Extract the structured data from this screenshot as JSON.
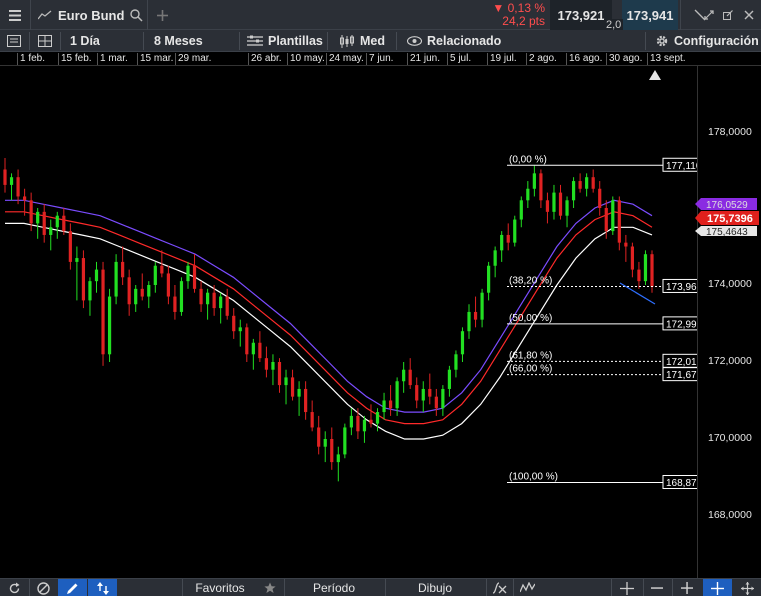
{
  "header": {
    "instrument": "Euro Bund",
    "change_pct": "▼ 0,13 %",
    "change_pts": "24,2 pts",
    "bid": "173,921",
    "spread": "2,0",
    "ask": "173,941"
  },
  "toolbar": {
    "interval": "1 Día",
    "range": "8 Meses",
    "templates": "Plantillas",
    "candle_type": "Med",
    "related": "Relacionado",
    "settings": "Configuración"
  },
  "date_axis": [
    "1 feb.",
    "15 feb.",
    "1 mar.",
    "15 mar.",
    "29 mar.",
    "26 abr.",
    "10 may.",
    "24 may.",
    "7 jun.",
    "21 jun.",
    "5 jul.",
    "19 jul.",
    "2 ago.",
    "16 ago.",
    "30 ago.",
    "13 sept."
  ],
  "price_axis": [
    "178,0000",
    "174,0000",
    "172,0000",
    "170,0000",
    "168,0000"
  ],
  "fibonacci": [
    {
      "level": "(0,00 %)",
      "price": "177,1100"
    },
    {
      "level": "(38,20 %)",
      "price": "173,9623"
    },
    {
      "level": "(50,00 %)",
      "price": "172,9900"
    },
    {
      "level": "(61,80 %)",
      "price": "172,0177"
    },
    {
      "level": "(66,00 %)",
      "price": "171,6716"
    },
    {
      "level": "(100,00 %)",
      "price": "168,8700"
    }
  ],
  "price_badges": {
    "purple": "176,0529",
    "current": "175,7396",
    "white": "175,4643"
  },
  "bottom": {
    "favorites": "Favoritos",
    "period": "Período",
    "drawing": "Dibujo"
  },
  "colors": {
    "up": "#22e022",
    "down": "#e02222",
    "ema_purple": "#7b4cff",
    "ema_red": "#ff2a2a",
    "ema_white": "#ffffff",
    "current_badge": "#e0201c",
    "purple_badge": "#8a2be2"
  },
  "chart_data": {
    "type": "candlestick",
    "ylim": [
      167.5,
      180.0
    ],
    "price_ticks": [
      178,
      174,
      172,
      170,
      168
    ],
    "candles": [
      [
        177.0,
        177.3,
        176.4,
        176.6
      ],
      [
        176.6,
        176.9,
        176.2,
        176.8
      ],
      [
        176.8,
        177.0,
        176.1,
        176.3
      ],
      [
        176.3,
        176.5,
        175.8,
        176.2
      ],
      [
        176.2,
        176.4,
        175.4,
        175.6
      ],
      [
        175.6,
        176.0,
        175.2,
        175.9
      ],
      [
        175.9,
        176.1,
        175.1,
        175.3
      ],
      [
        175.3,
        175.7,
        174.9,
        175.5
      ],
      [
        175.5,
        175.9,
        175.2,
        175.8
      ],
      [
        175.8,
        176.0,
        175.3,
        175.4
      ],
      [
        175.4,
        175.6,
        174.4,
        174.6
      ],
      [
        174.6,
        175.0,
        173.6,
        174.7
      ],
      [
        174.7,
        174.9,
        173.4,
        173.6
      ],
      [
        173.6,
        174.2,
        173.2,
        174.1
      ],
      [
        174.1,
        174.6,
        173.8,
        174.4
      ],
      [
        174.4,
        174.6,
        171.9,
        172.2
      ],
      [
        172.2,
        173.9,
        172.0,
        173.7
      ],
      [
        173.7,
        174.8,
        173.5,
        174.6
      ],
      [
        174.6,
        175.0,
        174.0,
        174.2
      ],
      [
        174.2,
        174.4,
        173.2,
        173.5
      ],
      [
        173.5,
        174.0,
        173.3,
        173.9
      ],
      [
        173.9,
        174.3,
        173.6,
        173.7
      ],
      [
        173.7,
        174.1,
        173.4,
        174.0
      ],
      [
        174.0,
        174.6,
        173.8,
        174.5
      ],
      [
        174.5,
        174.9,
        174.2,
        174.3
      ],
      [
        174.3,
        174.5,
        173.5,
        173.7
      ],
      [
        173.7,
        174.0,
        173.1,
        173.3
      ],
      [
        173.3,
        174.2,
        173.2,
        174.1
      ],
      [
        174.1,
        174.6,
        173.9,
        174.5
      ],
      [
        174.5,
        174.8,
        173.8,
        173.9
      ],
      [
        173.9,
        174.1,
        173.3,
        173.5
      ],
      [
        173.5,
        173.9,
        173.1,
        173.8
      ],
      [
        173.8,
        174.0,
        173.2,
        173.4
      ],
      [
        173.4,
        173.8,
        173.0,
        173.7
      ],
      [
        173.7,
        173.9,
        173.1,
        173.2
      ],
      [
        173.2,
        173.4,
        172.6,
        172.8
      ],
      [
        172.8,
        173.1,
        172.4,
        172.9
      ],
      [
        172.9,
        173.0,
        172.0,
        172.2
      ],
      [
        172.2,
        172.6,
        171.8,
        172.5
      ],
      [
        172.5,
        172.8,
        172.0,
        172.1
      ],
      [
        172.1,
        172.4,
        171.6,
        171.8
      ],
      [
        171.8,
        172.2,
        171.4,
        172.0
      ],
      [
        172.0,
        172.1,
        171.2,
        171.4
      ],
      [
        171.4,
        171.8,
        170.9,
        171.6
      ],
      [
        171.6,
        171.8,
        171.0,
        171.1
      ],
      [
        171.1,
        171.5,
        170.6,
        171.3
      ],
      [
        171.3,
        171.5,
        170.5,
        170.7
      ],
      [
        170.7,
        171.0,
        170.2,
        170.3
      ],
      [
        170.3,
        170.6,
        169.6,
        169.8
      ],
      [
        169.8,
        170.2,
        169.4,
        170.0
      ],
      [
        170.0,
        170.3,
        169.2,
        169.4
      ],
      [
        169.4,
        169.8,
        168.9,
        169.6
      ],
      [
        169.6,
        170.4,
        169.5,
        170.3
      ],
      [
        170.3,
        170.8,
        170.1,
        170.6
      ],
      [
        170.6,
        170.8,
        170.0,
        170.2
      ],
      [
        170.2,
        170.6,
        169.9,
        170.5
      ],
      [
        170.5,
        170.9,
        170.3,
        170.4
      ],
      [
        170.4,
        170.8,
        170.2,
        170.7
      ],
      [
        170.7,
        171.2,
        170.5,
        171.0
      ],
      [
        171.0,
        171.4,
        170.6,
        170.8
      ],
      [
        170.8,
        171.6,
        170.6,
        171.5
      ],
      [
        171.5,
        172.0,
        171.2,
        171.8
      ],
      [
        171.8,
        172.1,
        171.3,
        171.4
      ],
      [
        171.4,
        171.6,
        170.8,
        171.0
      ],
      [
        171.0,
        171.5,
        170.7,
        171.3
      ],
      [
        171.3,
        171.7,
        170.9,
        171.1
      ],
      [
        171.1,
        171.3,
        170.6,
        170.8
      ],
      [
        170.8,
        171.4,
        170.6,
        171.3
      ],
      [
        171.3,
        171.9,
        171.1,
        171.8
      ],
      [
        171.8,
        172.3,
        171.6,
        172.2
      ],
      [
        172.2,
        172.9,
        172.0,
        172.8
      ],
      [
        172.8,
        173.5,
        172.6,
        173.3
      ],
      [
        173.3,
        173.7,
        172.9,
        173.1
      ],
      [
        173.1,
        173.9,
        172.9,
        173.8
      ],
      [
        173.8,
        174.6,
        173.6,
        174.5
      ],
      [
        174.5,
        175.0,
        174.2,
        174.9
      ],
      [
        174.9,
        175.4,
        174.6,
        175.3
      ],
      [
        175.3,
        175.6,
        174.9,
        175.1
      ],
      [
        175.1,
        175.8,
        175.0,
        175.7
      ],
      [
        175.7,
        176.3,
        175.5,
        176.2
      ],
      [
        176.2,
        176.7,
        176.0,
        176.5
      ],
      [
        176.5,
        177.1,
        176.3,
        176.9
      ],
      [
        176.9,
        177.0,
        176.0,
        176.2
      ],
      [
        176.2,
        176.4,
        175.6,
        175.9
      ],
      [
        175.9,
        176.6,
        175.7,
        176.4
      ],
      [
        176.4,
        176.6,
        175.7,
        175.8
      ],
      [
        175.8,
        176.3,
        175.5,
        176.2
      ],
      [
        176.2,
        176.8,
        176.0,
        176.7
      ],
      [
        176.7,
        176.9,
        176.4,
        176.5
      ],
      [
        176.5,
        176.9,
        176.3,
        176.8
      ],
      [
        176.8,
        177.0,
        176.4,
        176.5
      ],
      [
        176.5,
        176.7,
        175.8,
        176.0
      ],
      [
        176.0,
        176.2,
        175.2,
        175.4
      ],
      [
        175.4,
        176.3,
        175.3,
        176.2
      ],
      [
        176.2,
        176.3,
        174.9,
        175.1
      ],
      [
        175.1,
        175.3,
        174.6,
        175.0
      ],
      [
        175.0,
        175.1,
        174.2,
        174.4
      ],
      [
        174.4,
        174.6,
        173.9,
        174.1
      ],
      [
        174.1,
        174.9,
        174.0,
        174.8
      ],
      [
        174.8,
        174.9,
        173.8,
        173.96
      ]
    ],
    "emas": {
      "purple": [
        176.2,
        176.2,
        176.1,
        176.0,
        175.9,
        175.8,
        175.6,
        175.4,
        175.2,
        175.0,
        174.8,
        174.5,
        174.2,
        173.8,
        173.4,
        173.0,
        172.5,
        172.0,
        171.5,
        171.1,
        170.8,
        170.7,
        170.7,
        170.8,
        171.2,
        171.8,
        172.6,
        173.4,
        174.2,
        175.0,
        175.6,
        176.0,
        176.2,
        176.1,
        175.8
      ],
      "red": [
        175.9,
        175.9,
        175.8,
        175.7,
        175.6,
        175.5,
        175.3,
        175.1,
        174.9,
        174.7,
        174.5,
        174.2,
        173.9,
        173.5,
        173.1,
        172.7,
        172.2,
        171.7,
        171.2,
        170.8,
        170.5,
        170.4,
        170.4,
        170.5,
        170.9,
        171.5,
        172.3,
        173.1,
        173.9,
        174.7,
        175.3,
        175.7,
        175.9,
        175.8,
        175.5
      ],
      "white": [
        175.6,
        175.6,
        175.5,
        175.4,
        175.3,
        175.2,
        175.0,
        174.8,
        174.6,
        174.4,
        174.2,
        173.9,
        173.6,
        173.2,
        172.8,
        172.4,
        171.9,
        171.4,
        170.9,
        170.5,
        170.2,
        170.0,
        170.0,
        170.1,
        170.4,
        170.9,
        171.6,
        172.4,
        173.2,
        174.0,
        174.7,
        175.2,
        175.5,
        175.5,
        175.3
      ]
    }
  }
}
